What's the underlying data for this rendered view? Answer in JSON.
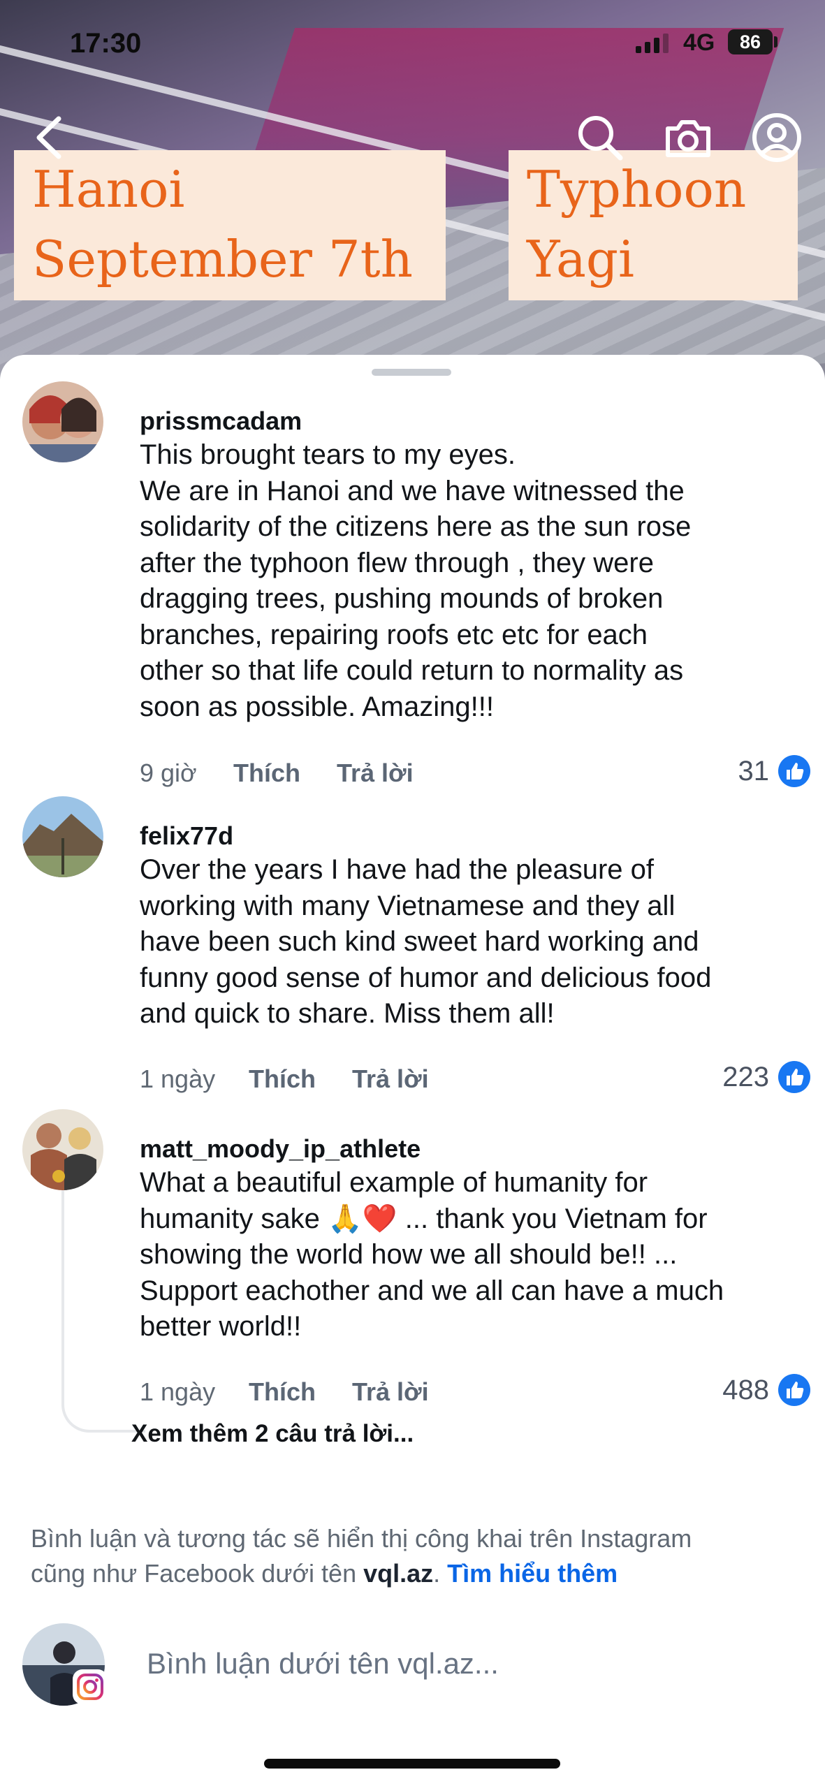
{
  "status_bar": {
    "time": "17:30",
    "network": "4G",
    "battery": "86"
  },
  "video": {
    "caption_left": [
      "Hanoi",
      "September 7th"
    ],
    "caption_right": [
      "Typhoon",
      "Yagi"
    ],
    "icons": [
      "back-icon",
      "search-icon",
      "camera-icon",
      "profile-icon"
    ]
  },
  "comments": [
    {
      "username": "prissmcadam",
      "text": [
        "This brought tears to my eyes.",
        "We are in Hanoi and we have witnessed the",
        "solidarity of the citizens here as the sun rose",
        "after the typhoon flew through , they were",
        "dragging trees, pushing mounds of broken",
        "branches, repairing roofs etc etc for each",
        "other so that life could return to normality as",
        "soon as possible. Amazing!!!"
      ],
      "time": "9 giờ",
      "like_label": "Thích",
      "reply_label": "Trả lời",
      "likes": "31"
    },
    {
      "username": "felix77d",
      "text": [
        "Over the years I have had the pleasure of",
        "working with many Vietnamese and they all",
        "have been such kind sweet hard working and",
        "funny good sense of humor and delicious food",
        "and quick to share. Miss them all!"
      ],
      "time": "1 ngày",
      "like_label": "Thích",
      "reply_label": "Trả lời",
      "likes": "223"
    },
    {
      "username": "matt_moody_ip_athlete",
      "text": [
        "What a beautiful example of humanity for",
        "humanity sake 🙏❤️ ... thank you Vietnam for",
        "showing the world how we all should be!! ...",
        "Support eachother and we all can have a much",
        "better world!!"
      ],
      "time": "1 ngày",
      "like_label": "Thích",
      "reply_label": "Trả lời",
      "likes": "488"
    }
  ],
  "more_replies": "Xem thêm 2 câu trả lời...",
  "notice": {
    "text_before": "Bình luận và tương tác sẽ hiển thị công khai trên Instagram",
    "text_line2": "cũng như Facebook dưới tên ",
    "account": "vql.az",
    "sep": ". ",
    "link": "Tìm hiểu thêm"
  },
  "composer": {
    "placeholder": "Bình luận dưới tên vql.az..."
  },
  "colors": {
    "link": "#0a66e6",
    "like_icon": "#1877f2",
    "caption_text": "#e8641a",
    "caption_bg": "#fbe9da"
  }
}
